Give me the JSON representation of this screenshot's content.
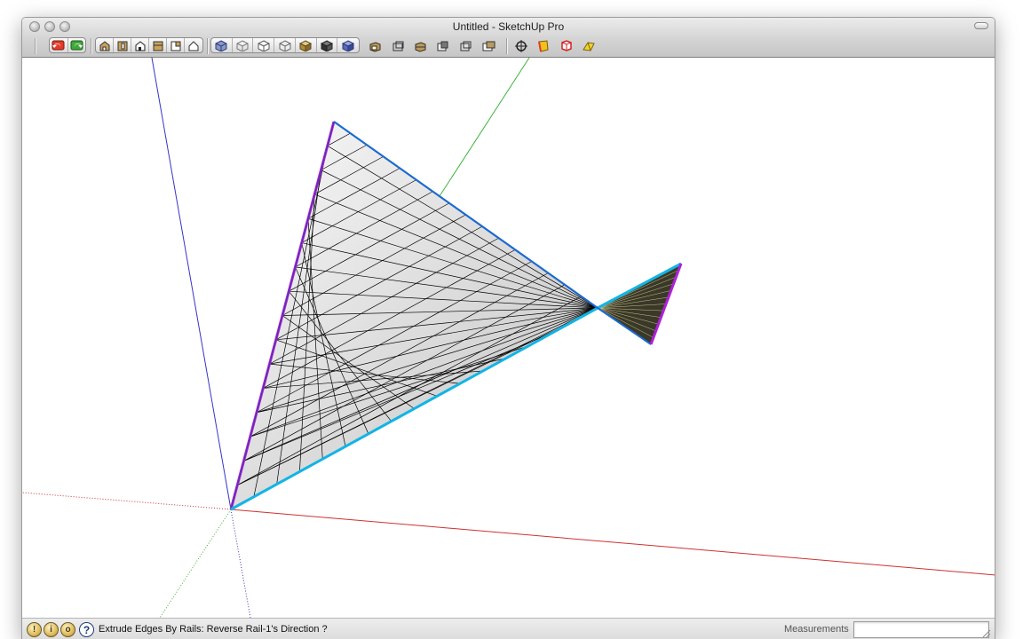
{
  "window": {
    "title": "Untitled - SketchUp Pro"
  },
  "toolbar": {
    "groups": [
      {
        "name": "undo-redo",
        "buttons": [
          "undo-icon",
          "redo-icon"
        ]
      },
      {
        "name": "standard-views",
        "buttons": [
          "iso-view-icon",
          "top-view-icon",
          "front-view-icon",
          "right-view-icon",
          "back-view-icon",
          "left-view-icon"
        ]
      },
      {
        "name": "face-styles",
        "buttons": [
          "xray-icon",
          "wireframe-icon",
          "hidden-line-icon",
          "shaded-icon",
          "shaded-textures-icon",
          "monochrome-icon",
          "monochrome-alt-icon"
        ]
      }
    ],
    "extra_buttons": [
      "section-plane-icon",
      "section-cut-icon",
      "display-section-icon",
      "display-cut-icon",
      "section-fill-icon",
      "extra-view-icon",
      "orbit-icon",
      "paint-bucket-icon",
      "component-icon",
      "tape-icon"
    ]
  },
  "status": {
    "message": "Extrude Edges By Rails: Reverse Rail-1's Direction ?",
    "measurements_label": "Measurements",
    "measurements_value": ""
  },
  "colors": {
    "red_axis": "#d03030",
    "green_axis": "#3cb43c",
    "blue_axis": "#3434c8",
    "rail_cyan": "#12b4e6",
    "rail_magenta": "#b020d8",
    "mesh_edge": "#000000"
  }
}
